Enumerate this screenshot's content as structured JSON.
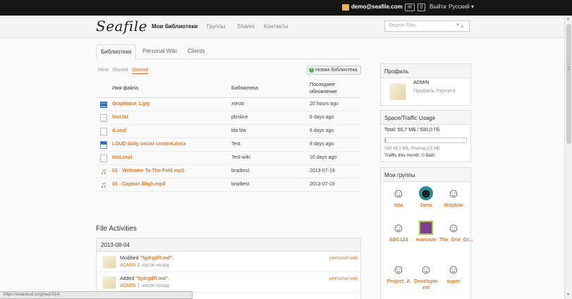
{
  "topbar": {
    "user": "demo@seafile.com",
    "message_count": "0",
    "logout": "Выйти",
    "language": "Русский ▾"
  },
  "header": {
    "logo": "Seafile",
    "nav": [
      "Мои библиотеки",
      "Группы",
      "Shares",
      "Контакты"
    ],
    "active_nav": "Мои библиотеки",
    "search_placeholder": "Search Files"
  },
  "tabs": [
    "Библиотеки",
    "Personal Wiki",
    "Clients"
  ],
  "subtabs": [
    "Mine",
    "Shared",
    "Starred"
  ],
  "new_library": "Новая библиотека",
  "table": {
    "headers": {
      "file": "Имя файла",
      "library": "Библиотека",
      "updated": "Последнее обновление"
    },
    "rows": [
      {
        "icon": "image-file-icon",
        "name": "Graphique 1.jpg",
        "library": "xtestx",
        "updated": "20 hours ago"
      },
      {
        "icon": "text-file-icon",
        "name": "test.txt",
        "library": "pleslice",
        "updated": "6 days ago"
      },
      {
        "icon": "blank-file-icon",
        "name": "d.seaf",
        "library": "bla bla",
        "updated": "6 days ago"
      },
      {
        "icon": "word-document-icon",
        "name": "LOUD daily social content.docx",
        "library": "Test",
        "updated": "8 days ago"
      },
      {
        "icon": "blank-file-icon",
        "name": "test.seaf",
        "library": "Test-wiki",
        "updated": "10 days ago"
      },
      {
        "icon": "music-file-icon",
        "name": "02 - Welcome To The Fold.mp3",
        "library": "bradtest",
        "updated": "2013-07-19"
      },
      {
        "icon": "music-file-icon",
        "name": "03 - Captain Bligh.mp3",
        "library": "bradtest",
        "updated": "2013-07-19"
      }
    ]
  },
  "activities": {
    "title": "File Activities",
    "date": "2013-08-04",
    "items": [
      {
        "verb": "Modified",
        "file": "\"fgdrgdff.md\"",
        "tail": ".",
        "user": "ADMIN",
        "time": "1 часов назад",
        "repo": "personal-wiki"
      },
      {
        "verb": "Added",
        "file": "\"fgdrgdff.md\"",
        "tail": ".",
        "user": "ADMIN",
        "time": "1 часов назад",
        "repo": "personal-wiki"
      }
    ]
  },
  "profile": {
    "title": "Профиль",
    "name": "ADMIN",
    "type": "Профиль Payment"
  },
  "usage": {
    "title": "Space/Traffic Usage",
    "total": "Total: 50,7 МБ / 500,0 ГБ",
    "fill_fraction": 0.0001,
    "breakdown": "Self 48,1 МБ, Sharing 2,5 МБ",
    "traffic": "Traffic this month: 0 байт"
  },
  "groups": {
    "title": "Мои группы",
    "items": [
      "tata",
      "Jams",
      "dropbox",
      "ABC123",
      "manusm",
      "The_One_Gr...",
      "Project_A",
      "Developm ent",
      "super"
    ]
  },
  "status_url": "https://seacloud.cc/group/314/",
  "colors": {
    "accent": "#e07b2b",
    "link": "#e06a2b"
  }
}
